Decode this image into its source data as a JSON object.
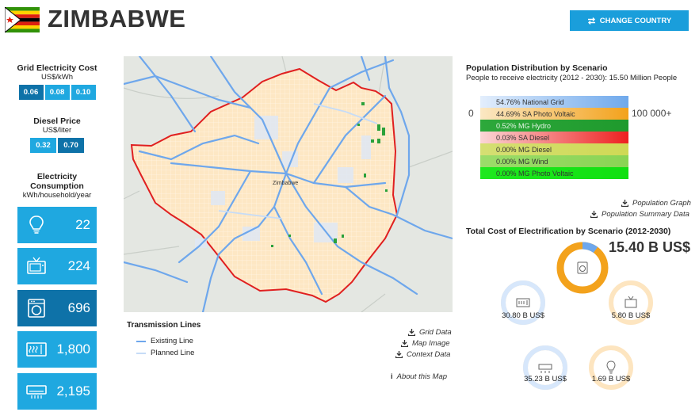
{
  "header": {
    "country": "ZIMBABWE",
    "change_button": "CHANGE COUNTRY"
  },
  "left_panel": {
    "grid_cost": {
      "title": "Grid Electricity Cost",
      "unit": "US$/kWh",
      "values": [
        "0.06",
        "0.08",
        "0.10"
      ],
      "selected_index": 0
    },
    "diesel_price": {
      "title": "Diesel Price",
      "unit": "US$/liter",
      "values": [
        "0.32",
        "0.70"
      ],
      "selected_index": 1
    },
    "consumption": {
      "title_line1": "Electricity",
      "title_line2": "Consumption",
      "unit": "kWh/household/year",
      "tiers": [
        {
          "value": "22",
          "icon": "lightbulb-icon",
          "selected": false
        },
        {
          "value": "224",
          "icon": "television-icon",
          "selected": false
        },
        {
          "value": "696",
          "icon": "washing-machine-icon",
          "selected": true
        },
        {
          "value": "1,800",
          "icon": "microwave-icon",
          "selected": false
        },
        {
          "value": "2,195",
          "icon": "air-conditioner-icon",
          "selected": false
        }
      ]
    }
  },
  "map": {
    "country_label": "Zimbabwe",
    "legend_title": "Transmission Lines",
    "legend": [
      {
        "label": "Existing Line",
        "color": "#6ea7ec"
      },
      {
        "label": "Planned Line",
        "color": "#c6dcf7"
      }
    ],
    "links": [
      "Grid Data",
      "Map Image",
      "Context Data",
      "About this Map"
    ],
    "colors": {
      "land": "#fde7c4",
      "border": "#e02020",
      "line": "#6ea7ec",
      "hydro": "#2aa13a"
    }
  },
  "population": {
    "title": "Population Distribution by Scenario",
    "subtitle": "People to receive electricity (2012 - 2030): 15.50 Million People",
    "scale_min": "0",
    "scale_max": "100 000+",
    "bars": [
      {
        "label": "54.76% National Grid",
        "color_from": "#e3eefc",
        "color_to": "#6fa9ec"
      },
      {
        "label": "44.69% SA Photo Voltaic",
        "color_from": "#fbe8c4",
        "color_to": "#f3a21c"
      },
      {
        "label": "0.52% MG Hydro",
        "color_from": "#2da83b",
        "color_to": "#1f9a2d"
      },
      {
        "label": "0.03% SA Diesel",
        "color_from": "#fbd6d6",
        "color_to": "#ee2020"
      },
      {
        "label": "0.00% MG Diesel",
        "color_from": "#d5df73",
        "color_to": "#cfd955"
      },
      {
        "label": "0.00% MG Wind",
        "color_from": "#9bdc6a",
        "color_to": "#8ad454"
      },
      {
        "label": "0.00% MG Photo Voltaic",
        "color_from": "#1ee81e",
        "color_to": "#11e011"
      }
    ],
    "links": [
      "Population Graph",
      "Population Summary Data"
    ]
  },
  "cost": {
    "title": "Total Cost of Electrification by Scenario (2012-2030)",
    "main_value": "15.40 B US$",
    "donuts": [
      {
        "label": "",
        "icon": "washing-machine-icon",
        "grid_fraction": 0.1,
        "pv_fraction": 0.9
      },
      {
        "label": "30.80 B US$",
        "icon": "microwave-icon",
        "grid_fraction": 1.0,
        "pv_fraction": 0.0
      },
      {
        "label": "5.80 B US$",
        "icon": "television-icon",
        "grid_fraction": 0.0,
        "pv_fraction": 1.0
      },
      {
        "label": "35.23 B US$",
        "icon": "air-conditioner-icon",
        "grid_fraction": 1.0,
        "pv_fraction": 0.0
      },
      {
        "label": "1.69 B US$",
        "icon": "lightbulb-icon",
        "grid_fraction": 0.0,
        "pv_fraction": 1.0
      }
    ]
  }
}
